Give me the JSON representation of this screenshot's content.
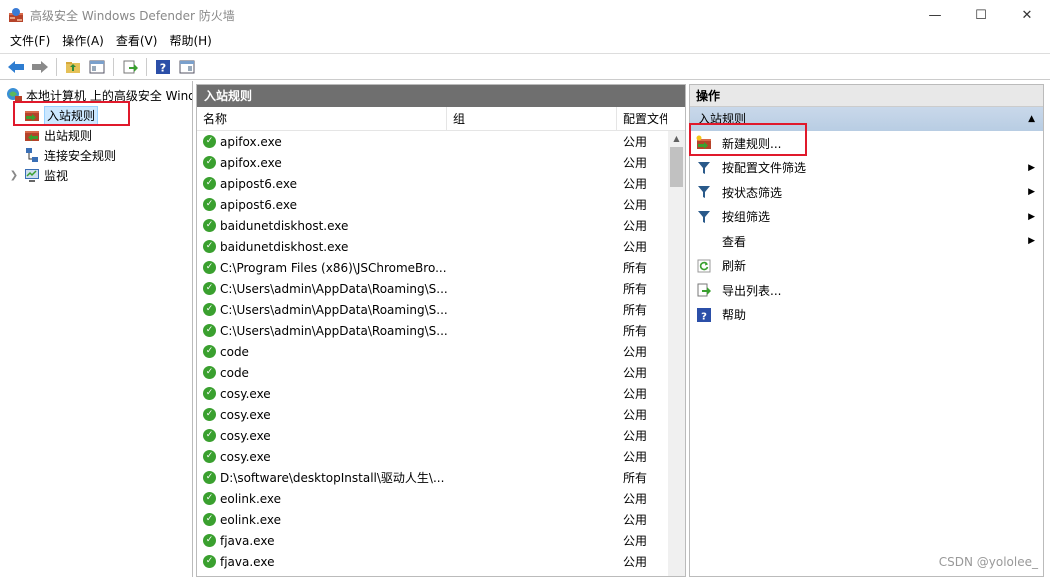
{
  "window": {
    "title": "高级安全 Windows Defender 防火墙",
    "minimize": "—",
    "maximize": "☐",
    "close": "✕"
  },
  "menu": [
    "文件(F)",
    "操作(A)",
    "查看(V)",
    "帮助(H)"
  ],
  "tree": {
    "root": "本地计算机 上的高级安全 Windows Defender 防火墙",
    "items": [
      {
        "label": "入站规则",
        "selected": true
      },
      {
        "label": "出站规则",
        "selected": false
      },
      {
        "label": "连接安全规则",
        "selected": false
      },
      {
        "label": "监视",
        "selected": false
      }
    ]
  },
  "middle": {
    "header": "入站规则",
    "columns": {
      "name": "名称",
      "group": "组",
      "profile": "配置文件"
    },
    "rows": [
      {
        "name": "apifox.exe",
        "profile": "公用"
      },
      {
        "name": "apifox.exe",
        "profile": "公用"
      },
      {
        "name": "apipost6.exe",
        "profile": "公用"
      },
      {
        "name": "apipost6.exe",
        "profile": "公用"
      },
      {
        "name": "baidunetdiskhost.exe",
        "profile": "公用"
      },
      {
        "name": "baidunetdiskhost.exe",
        "profile": "公用"
      },
      {
        "name": "C:\\Program Files (x86)\\JSChromeBro...",
        "profile": "所有"
      },
      {
        "name": "C:\\Users\\admin\\AppData\\Roaming\\S...",
        "profile": "所有"
      },
      {
        "name": "C:\\Users\\admin\\AppData\\Roaming\\S...",
        "profile": "所有"
      },
      {
        "name": "C:\\Users\\admin\\AppData\\Roaming\\S...",
        "profile": "所有"
      },
      {
        "name": "code",
        "profile": "公用"
      },
      {
        "name": "code",
        "profile": "公用"
      },
      {
        "name": "cosy.exe",
        "profile": "公用"
      },
      {
        "name": "cosy.exe",
        "profile": "公用"
      },
      {
        "name": "cosy.exe",
        "profile": "公用"
      },
      {
        "name": "cosy.exe",
        "profile": "公用"
      },
      {
        "name": "D:\\software\\desktopInstall\\驱动人生\\...",
        "profile": "所有"
      },
      {
        "name": "eolink.exe",
        "profile": "公用"
      },
      {
        "name": "eolink.exe",
        "profile": "公用"
      },
      {
        "name": "fjava.exe",
        "profile": "公用"
      },
      {
        "name": "fjava.exe",
        "profile": "公用"
      }
    ]
  },
  "actions": {
    "header": "操作",
    "section": "入站规则",
    "items": [
      {
        "label": "新建规则...",
        "icon": "new-rule-icon",
        "submenu": false
      },
      {
        "label": "按配置文件筛选",
        "icon": "filter-icon",
        "submenu": true
      },
      {
        "label": "按状态筛选",
        "icon": "filter-icon",
        "submenu": true
      },
      {
        "label": "按组筛选",
        "icon": "filter-icon",
        "submenu": true
      },
      {
        "label": "查看",
        "icon": "",
        "submenu": true
      },
      {
        "label": "刷新",
        "icon": "refresh-icon",
        "submenu": false
      },
      {
        "label": "导出列表...",
        "icon": "export-icon",
        "submenu": false
      },
      {
        "label": "帮助",
        "icon": "help-icon",
        "submenu": false
      }
    ]
  },
  "watermark": "CSDN @yololee_",
  "colors": {
    "accent": "#e0192b",
    "selection": "#cce8ff",
    "check": "#3aa02f",
    "pane_header": "#6f6f6f"
  }
}
